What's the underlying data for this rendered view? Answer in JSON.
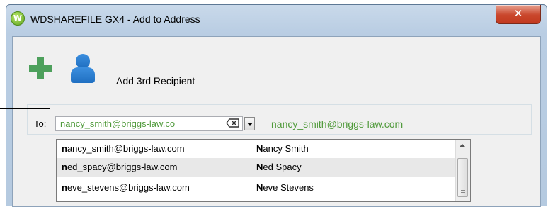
{
  "window": {
    "title": "WDSHAREFILE GX4 - Add to Address",
    "app_icon_letter": "W",
    "close_glyph": "✕"
  },
  "toolbar": {
    "add_icon": "plus-icon",
    "person_icon": "person-icon",
    "add_label": "Add 3rd Recipient"
  },
  "recipient": {
    "to_label": "To:",
    "input_value": "nancy_smith@briggs-law.co",
    "resolved_email": "nancy_smith@briggs-law.com"
  },
  "suggestions": [
    {
      "email": "nancy_smith@briggs-law.com",
      "name": "Nancy Smith",
      "prefix": "n",
      "name_prefix": "N"
    },
    {
      "email": "ned_spacy@briggs-law.com",
      "name": "Ned Spacy",
      "prefix": "n",
      "name_prefix": "N"
    },
    {
      "email": "neve_stevens@briggs-law.com",
      "name": "Neve Stevens",
      "prefix": "n",
      "name_prefix": "N"
    }
  ],
  "colors": {
    "accent_green": "#4f9a3a",
    "close_red": "#c9462c",
    "icon_blue": "#1f6fc1"
  }
}
